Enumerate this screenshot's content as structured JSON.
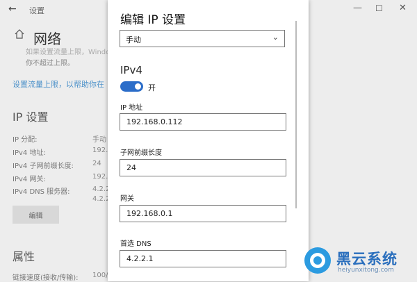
{
  "settings_window": {
    "app_title": "设置",
    "page_title": "网络",
    "faded_lines": [
      "如果设置流量上限，Windows",
      "你不超过上限。"
    ],
    "data_limit_link": "设置流量上限，以帮助你在",
    "ip_section_title": "IP 设置",
    "ip_props": [
      {
        "label": "IP 分配:",
        "value": "手动"
      },
      {
        "label": "IPv4 地址:",
        "value": "192."
      },
      {
        "label": "IPv4 子网前缀长度:",
        "value": "24"
      },
      {
        "label": "IPv4 网关:",
        "value": "192."
      },
      {
        "label": "IPv4 DNS 服务器:",
        "value": "4.2.2."
      },
      {
        "label": "",
        "value": "4.2.2."
      }
    ],
    "edit_button": "编辑",
    "properties_title": "属性",
    "link_speed_label": "链接速度(接收/传输):",
    "link_speed_value": "100/"
  },
  "dialog": {
    "title": "编辑 IP 设置",
    "mode_selected": "手动",
    "section": "IPv4",
    "toggle_state": "开",
    "fields": [
      {
        "label": "IP 地址",
        "value": "192.168.0.112"
      },
      {
        "label": "子网前缀长度",
        "value": "24"
      },
      {
        "label": "网关",
        "value": "192.168.0.1"
      },
      {
        "label": "首选 DNS",
        "value": "4.2.2.1"
      }
    ]
  },
  "watermark": {
    "text": "黑云系统",
    "url": "heiyunxitong.com"
  },
  "colors": {
    "accent": "#2b6dc9",
    "link": "#4a90c9"
  }
}
